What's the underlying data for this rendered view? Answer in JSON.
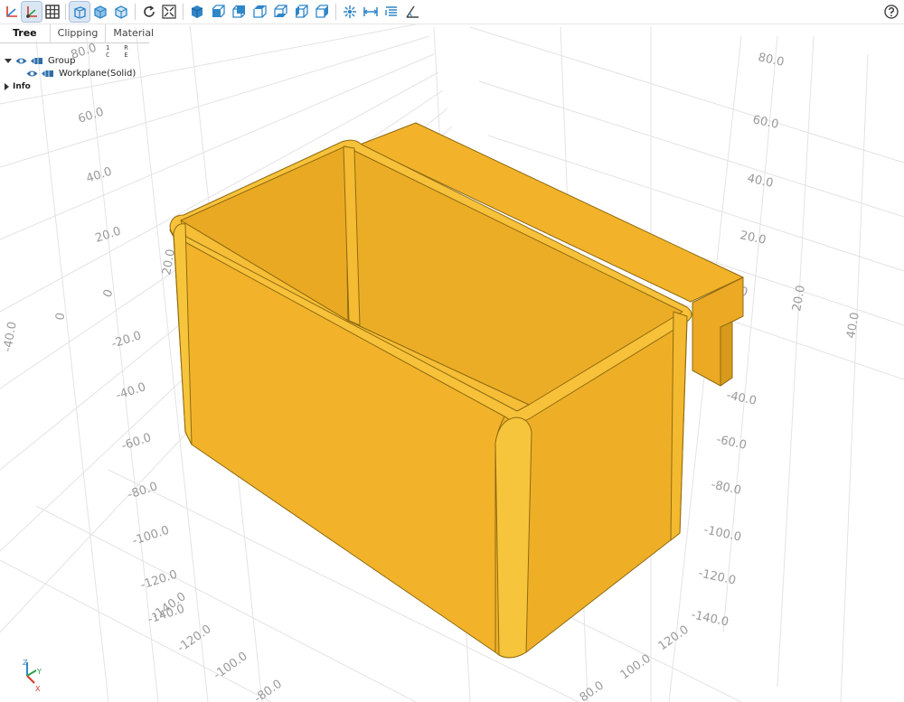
{
  "toolbar": {
    "buttons": [
      {
        "name": "axes-toggle-icon",
        "active": false
      },
      {
        "name": "axes-at-origin-icon",
        "active": true
      },
      {
        "name": "grid-toggle-icon",
        "active": false
      },
      {
        "name": "perspective-view-icon",
        "active": true
      },
      {
        "name": "transparent-view-icon",
        "active": false
      },
      {
        "name": "black-edges-icon",
        "active": false
      },
      {
        "name": "reset-view-icon",
        "active": false
      },
      {
        "name": "fit-view-icon",
        "active": false
      },
      {
        "name": "iso-view-icon",
        "active": false
      },
      {
        "name": "front-view-icon",
        "active": false
      },
      {
        "name": "rear-view-icon",
        "active": false
      },
      {
        "name": "top-view-icon",
        "active": false
      },
      {
        "name": "bottom-view-icon",
        "active": false
      },
      {
        "name": "left-view-icon",
        "active": false
      },
      {
        "name": "right-view-icon",
        "active": false
      },
      {
        "name": "explode-icon",
        "active": false
      },
      {
        "name": "distance-measure-icon",
        "active": false
      },
      {
        "name": "properties-icon",
        "active": false
      },
      {
        "name": "angle-measure-icon",
        "active": false
      },
      {
        "name": "help-icon",
        "active": false
      }
    ]
  },
  "tabs": [
    "Tree",
    "Clipping",
    "Material"
  ],
  "tree": {
    "columns": "1 R C E",
    "group_label": "Group",
    "child_label": "Workplane(Solid)",
    "info_label": "Info"
  },
  "orientation": {
    "z": "Z",
    "y": "Y",
    "x": "X"
  },
  "axis_labels": {
    "left_x": [
      "60.0",
      "40.0",
      "20.0",
      "0",
      "-20.0",
      "-40.0",
      "-60.0",
      "-80.0",
      "-100.0",
      "-120.0",
      "-140.0"
    ],
    "left_y": [
      "80.0",
      "60.0",
      "40.0",
      "20.0",
      "0",
      "-20.0",
      "-40.0"
    ],
    "left_z": [
      "20.0"
    ],
    "right_z": [
      "80.0",
      "60.0",
      "40.0",
      "20.0",
      "0",
      "-20.0",
      "-40.0",
      "-60.0",
      "-80.0",
      "-100.0",
      "-120.0",
      "-140.0"
    ],
    "right_y": [
      "20.0",
      "40.0",
      "60.0"
    ],
    "bottom_x": [
      "-140.0",
      "-120.0",
      "-100.0",
      "-80.0"
    ],
    "bottom_y": [
      "120.0",
      "100.0",
      "80.0"
    ]
  },
  "colors": {
    "solid": "#f2b32a",
    "solid_dark": "#e0a21f",
    "solid_light": "#f7c23a",
    "edge": "#8f6a10",
    "grid": "#e6e6e6",
    "accent": "#2f86c9"
  }
}
